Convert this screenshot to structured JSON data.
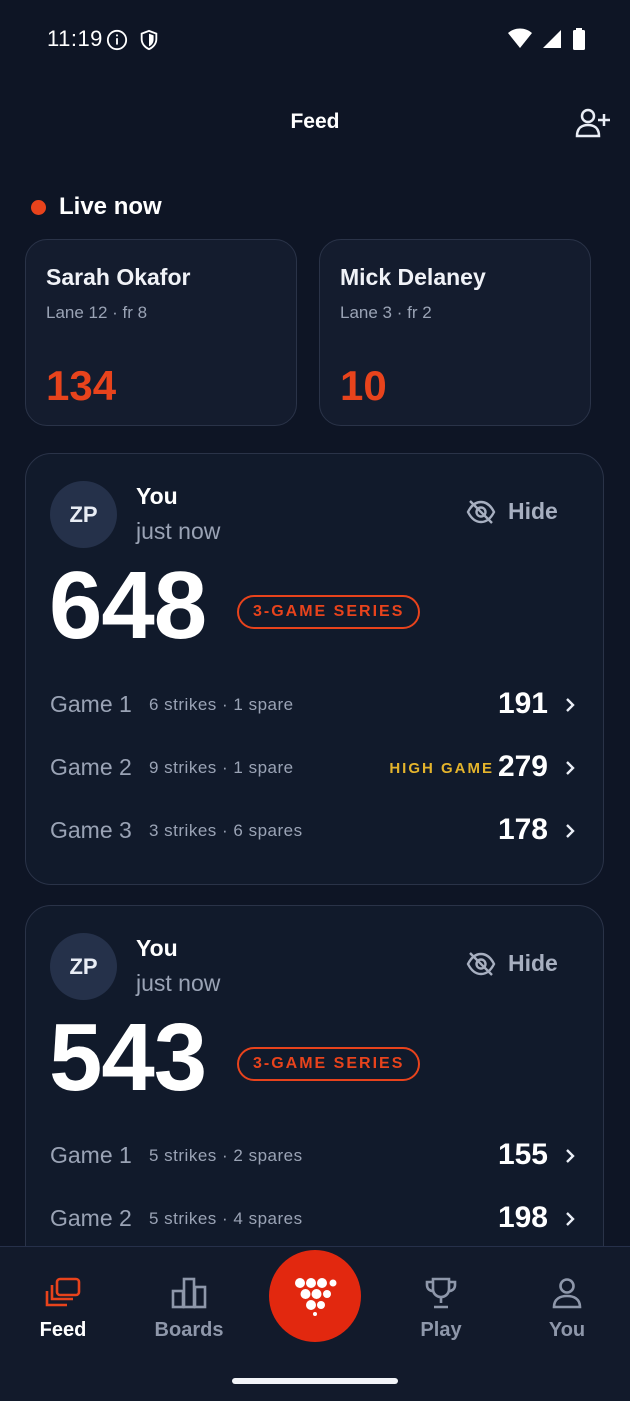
{
  "status_bar": {
    "time": "11:19"
  },
  "header": {
    "title": "Feed"
  },
  "live": {
    "label": "Live now",
    "cards": [
      {
        "name": "Sarah Okafor",
        "meta": "Lane 12 · fr 8",
        "score": "134"
      },
      {
        "name": "Mick Delaney",
        "meta": "Lane 3 · fr 2",
        "score": "10"
      }
    ]
  },
  "feed": [
    {
      "initials": "ZP",
      "who": "You",
      "when": "just now",
      "hide_label": "Hide",
      "score": "648",
      "badge": "3-GAME SERIES",
      "games": [
        {
          "label": "Game 1",
          "detail": "6 strikes · 1 spare",
          "high": "",
          "score": "191"
        },
        {
          "label": "Game 2",
          "detail": "9 strikes · 1 spare",
          "high": "HIGH GAME",
          "score": "279"
        },
        {
          "label": "Game 3",
          "detail": "3 strikes · 6 spares",
          "high": "",
          "score": "178"
        }
      ]
    },
    {
      "initials": "ZP",
      "who": "You",
      "when": "just now",
      "hide_label": "Hide",
      "score": "543",
      "badge": "3-GAME SERIES",
      "games": [
        {
          "label": "Game 1",
          "detail": "5 strikes · 2 spares",
          "high": "",
          "score": "155"
        },
        {
          "label": "Game 2",
          "detail": "5 strikes · 4 spares",
          "high": "",
          "score": "198"
        }
      ]
    }
  ],
  "nav": {
    "feed": "Feed",
    "boards": "Boards",
    "play": "Play",
    "you": "You",
    "active": "feed"
  },
  "colors": {
    "accent": "#e8431c",
    "high_game": "#e4b42c",
    "background": "#0e1525"
  }
}
